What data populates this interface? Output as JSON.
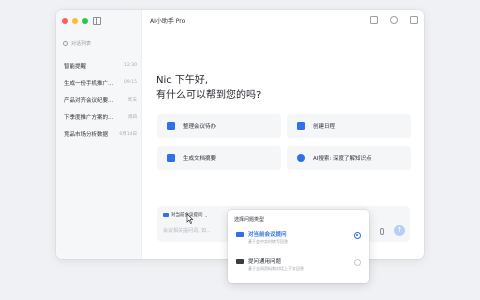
{
  "app": {
    "title": "AI小助手 Pro"
  },
  "sidebar": {
    "history_label": "对话列表",
    "items": [
      {
        "label": "智能提醒",
        "time": "12:30"
      },
      {
        "label": "生成一份手机推广…",
        "time": "09:15"
      },
      {
        "label": "产品对齐会议纪要…",
        "time": "昨天"
      },
      {
        "label": "下季度推广方案的…",
        "time": "周四"
      },
      {
        "label": "竞品市场分析数据",
        "time": "6月14日"
      }
    ]
  },
  "greeting": {
    "line1": "Nic 下午好,",
    "line2": "有什么可以帮到您的吗?"
  },
  "cards": [
    {
      "label": "整理会议待办"
    },
    {
      "label": "创建日程"
    },
    {
      "label": "生成文档摘要"
    },
    {
      "label": "AI搜索: 深度了解知识点"
    }
  ],
  "composer": {
    "chip_label": "对当前会议提问",
    "placeholder": "会议相关提问词, 如..."
  },
  "popup": {
    "title": "选择问题类型",
    "options": [
      {
        "label": "对当前会议提问",
        "desc": "基于会中实时转写回答",
        "selected": true
      },
      {
        "label": "提问通用问题",
        "desc": "基于全网资料和对话上下文回答",
        "selected": false
      }
    ]
  },
  "colors": {
    "accent": "#2f6fe8",
    "background": "#f0f1f4"
  }
}
